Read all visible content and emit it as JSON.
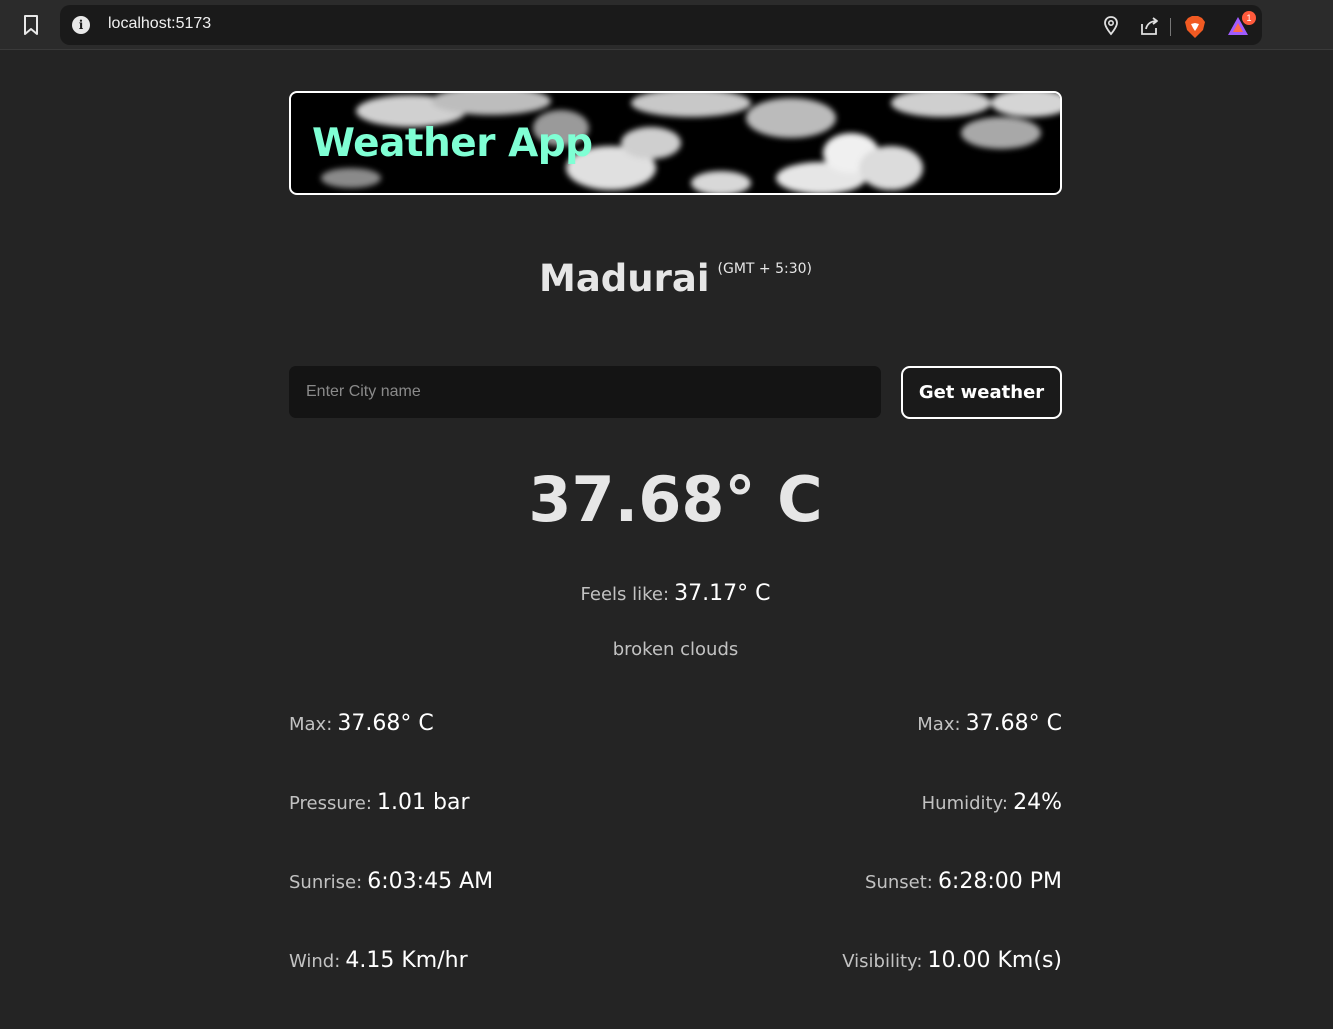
{
  "browser": {
    "url": "localhost:5173",
    "notification_count": "1"
  },
  "header": {
    "title": "Weather App"
  },
  "location": {
    "city": "Madurai",
    "timezone": "(GMT + 5:30)"
  },
  "search": {
    "placeholder": "Enter City name",
    "value": "",
    "button_label": "Get weather"
  },
  "current": {
    "temperature": "37.68° C",
    "feels_like_label": "Feels like:",
    "feels_like_value": "37.17° C",
    "description": "broken clouds"
  },
  "stats": {
    "left": [
      {
        "label": "Max:",
        "value": "37.68° C"
      },
      {
        "label": "Pressure:",
        "value": "1.01 bar"
      },
      {
        "label": "Sunrise:",
        "value": "6:03:45 AM"
      },
      {
        "label": "Wind:",
        "value": "4.15 Km/hr"
      }
    ],
    "right": [
      {
        "label": "Max:",
        "value": "37.68° C"
      },
      {
        "label": "Humidity:",
        "value": "24%"
      },
      {
        "label": "Sunset:",
        "value": "6:28:00 PM"
      },
      {
        "label": "Visibility:",
        "value": "10.00 Km(s)"
      }
    ]
  },
  "colors": {
    "background": "#242424",
    "title_accent": "#7fffd4",
    "input_bg": "#141414"
  },
  "icons": [
    "bookmark-icon",
    "info-icon",
    "location-pin-icon",
    "share-icon",
    "brave-lion-icon",
    "brave-rewards-icon"
  ]
}
